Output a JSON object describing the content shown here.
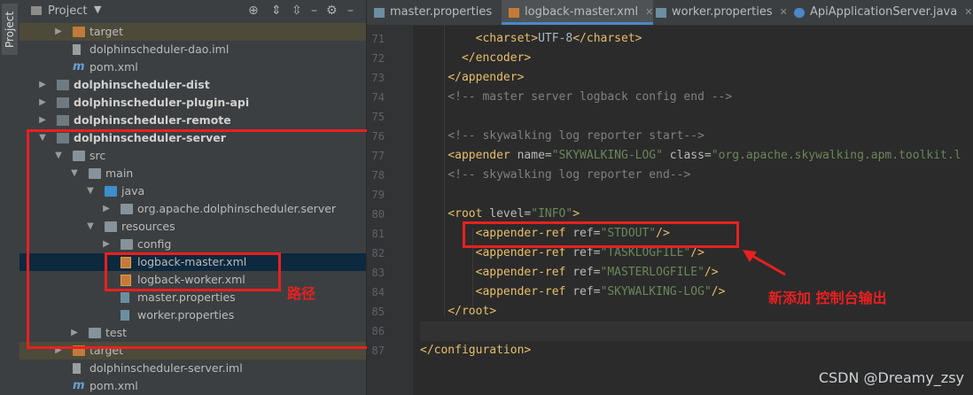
{
  "sidebar_strip": {
    "label": "Project"
  },
  "project_panel": {
    "title": "Project",
    "toolbar_icons": [
      "target-icon",
      "collapse-icon",
      "expand-icon",
      "close-icon",
      "gear-icon",
      "minimize-icon"
    ]
  },
  "tree": [
    {
      "label": "target",
      "icon": "folder-orange",
      "arrow": "right",
      "indent": 1,
      "bold": false,
      "highlight": true
    },
    {
      "label": "dolphinscheduler-dao.iml",
      "icon": "iml-file",
      "arrow": "",
      "indent": 1,
      "bold": false
    },
    {
      "label": "pom.xml",
      "icon": "maven-file",
      "arrow": "",
      "indent": 1,
      "bold": false
    },
    {
      "label": "dolphinscheduler-dist",
      "icon": "module-folder",
      "arrow": "right",
      "indent": 0,
      "bold": true
    },
    {
      "label": "dolphinscheduler-plugin-api",
      "icon": "module-folder",
      "arrow": "right",
      "indent": 0,
      "bold": true
    },
    {
      "label": "dolphinscheduler-remote",
      "icon": "module-folder",
      "arrow": "right",
      "indent": 0,
      "bold": true
    },
    {
      "label": "dolphinscheduler-server",
      "icon": "module-folder",
      "arrow": "down",
      "indent": 0,
      "bold": true
    },
    {
      "label": "src",
      "icon": "folder",
      "arrow": "down",
      "indent": 1,
      "bold": false
    },
    {
      "label": "main",
      "icon": "folder",
      "arrow": "down",
      "indent": 2,
      "bold": false
    },
    {
      "label": "java",
      "icon": "folder-blue",
      "arrow": "down",
      "indent": 3,
      "bold": false
    },
    {
      "label": "org.apache.dolphinscheduler.server",
      "icon": "folder",
      "arrow": "right",
      "indent": 4,
      "bold": false
    },
    {
      "label": "resources",
      "icon": "resources-folder",
      "arrow": "down",
      "indent": 3,
      "bold": false
    },
    {
      "label": "config",
      "icon": "folder",
      "arrow": "right",
      "indent": 4,
      "bold": false
    },
    {
      "label": "logback-master.xml",
      "icon": "xml-file",
      "arrow": "",
      "indent": 4,
      "bold": false,
      "selected": true
    },
    {
      "label": "logback-worker.xml",
      "icon": "xml-file",
      "arrow": "",
      "indent": 4,
      "bold": false
    },
    {
      "label": "master.properties",
      "icon": "properties-file",
      "arrow": "",
      "indent": 4,
      "bold": false
    },
    {
      "label": "worker.properties",
      "icon": "properties-file",
      "arrow": "",
      "indent": 4,
      "bold": false
    },
    {
      "label": "test",
      "icon": "folder",
      "arrow": "right",
      "indent": 2,
      "bold": false
    },
    {
      "label": "target",
      "icon": "folder-orange",
      "arrow": "right",
      "indent": 1,
      "bold": false,
      "highlight": true
    },
    {
      "label": "dolphinscheduler-server.iml",
      "icon": "iml-file",
      "arrow": "",
      "indent": 1,
      "bold": false
    },
    {
      "label": "pom.xml",
      "icon": "maven-file",
      "arrow": "",
      "indent": 1,
      "bold": false
    }
  ],
  "annotations": {
    "path_label": "路径",
    "new_label": "新添加  控制台输出",
    "red": "#e82020"
  },
  "tabs": [
    {
      "label": "master.properties",
      "icon": "properties-file",
      "active": false,
      "close": false
    },
    {
      "label": "logback-master.xml",
      "icon": "xml-file",
      "active": true,
      "close": true
    },
    {
      "label": "worker.properties",
      "icon": "properties-file",
      "active": false,
      "close": true
    },
    {
      "label": "ApiApplicationServer.java",
      "icon": "java-class",
      "active": false,
      "close": true
    }
  ],
  "code_lines": [
    {
      "num": "71",
      "indent": 8,
      "tokens": [
        [
          "tag",
          "<charset>"
        ],
        [
          "txt",
          "UTF-8"
        ],
        [
          "tag",
          "</charset>"
        ]
      ]
    },
    {
      "num": "72",
      "indent": 6,
      "tokens": [
        [
          "tag",
          "</encoder>"
        ]
      ]
    },
    {
      "num": "73",
      "indent": 4,
      "tokens": [
        [
          "tag",
          "</appender>"
        ]
      ]
    },
    {
      "num": "74",
      "indent": 4,
      "tokens": [
        [
          "cmt",
          "<!-- master server logback config end -->"
        ]
      ]
    },
    {
      "num": "75",
      "indent": 0,
      "tokens": []
    },
    {
      "num": "76",
      "indent": 4,
      "tokens": [
        [
          "cmt",
          "<!-- skywalking log reporter start-->"
        ]
      ]
    },
    {
      "num": "77",
      "indent": 4,
      "tokens": [
        [
          "tag",
          "<appender "
        ],
        [
          "attr",
          "name="
        ],
        [
          "val",
          "\"SKYWALKING-LOG\" "
        ],
        [
          "attr",
          "class="
        ],
        [
          "val",
          "\"org.apache.skywalking.apm.toolkit.l"
        ]
      ]
    },
    {
      "num": "78",
      "indent": 4,
      "tokens": [
        [
          "cmt",
          "<!-- skywalking log reporter end-->"
        ]
      ]
    },
    {
      "num": "79",
      "indent": 0,
      "tokens": []
    },
    {
      "num": "80",
      "indent": 4,
      "tokens": [
        [
          "tag",
          "<root "
        ],
        [
          "attr",
          "level="
        ],
        [
          "val",
          "\"INFO\""
        ],
        [
          "tag",
          ">"
        ]
      ]
    },
    {
      "num": "81",
      "indent": 8,
      "tokens": [
        [
          "tag",
          "<appender-ref "
        ],
        [
          "attr",
          "ref="
        ],
        [
          "val",
          "\"STDOUT\""
        ],
        [
          "tag",
          "/>"
        ]
      ]
    },
    {
      "num": "82",
      "indent": 8,
      "tokens": [
        [
          "tag",
          "<appender-ref "
        ],
        [
          "attr",
          "ref="
        ],
        [
          "val",
          "\"TASKLOGFILE\""
        ],
        [
          "tag",
          "/>"
        ]
      ]
    },
    {
      "num": "83",
      "indent": 8,
      "tokens": [
        [
          "tag",
          "<appender-ref "
        ],
        [
          "attr",
          "ref="
        ],
        [
          "val",
          "\"MASTERLOGFILE\""
        ],
        [
          "tag",
          "/>"
        ]
      ]
    },
    {
      "num": "84",
      "indent": 8,
      "tokens": [
        [
          "tag",
          "<appender-ref "
        ],
        [
          "attr",
          "ref="
        ],
        [
          "val",
          "\"SKYWALKING-LOG\""
        ],
        [
          "tag",
          "/>"
        ]
      ]
    },
    {
      "num": "85",
      "indent": 4,
      "tokens": [
        [
          "tag",
          "</root>"
        ]
      ]
    },
    {
      "num": "86",
      "indent": 0,
      "tokens": [],
      "current": true
    },
    {
      "num": "87",
      "indent": 0,
      "tokens": [
        [
          "tag",
          "</configuration>"
        ]
      ]
    }
  ],
  "watermark": "CSDN @Dreamy_zsy"
}
